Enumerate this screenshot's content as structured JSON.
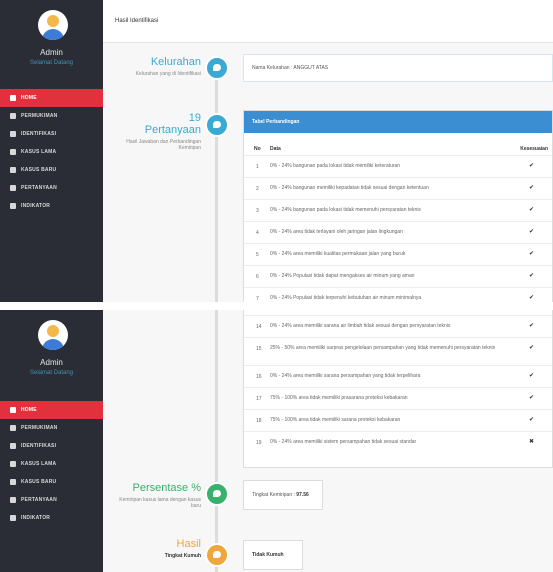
{
  "sidebar": {
    "username": "Admin",
    "role": "Selamat Datang",
    "items": [
      {
        "label": "HOME",
        "icon": "home-icon",
        "active": true
      },
      {
        "label": "PERMUKIMAN",
        "icon": "people-icon",
        "active": false
      },
      {
        "label": "IDENTIFIKASI",
        "icon": "wrench-icon",
        "active": false
      },
      {
        "label": "KASUS LAMA",
        "icon": "bookmark-icon",
        "active": false
      },
      {
        "label": "KASUS BARU",
        "icon": "list-icon",
        "active": false
      },
      {
        "label": "PERTANYAAN",
        "icon": "chat-icon",
        "active": false
      },
      {
        "label": "INDIKATOR",
        "icon": "chart-icon",
        "active": false
      }
    ]
  },
  "header": {
    "title": "Hasil Identifikasi"
  },
  "kelurahan": {
    "title": "Kelurahan",
    "subtitle": "Kelurahan yang di Identifikasi",
    "value": "Nama Kelurahan : ANGGUT ATAS"
  },
  "pertanyaan": {
    "count": "19",
    "title": "Pertanyaan",
    "subtitle": "Hasil Jawaban dan Perbandingan Kemiripan"
  },
  "table": {
    "title": "Tabel Perbandingan",
    "col_no": "No",
    "col_data": "Data",
    "col_match": "Kesesuaian",
    "rows_top": [
      {
        "no": "1",
        "text": "0% - 24% bangunan pada lokasi tidak memiliki keteraturan",
        "mark": "✔"
      },
      {
        "no": "2",
        "text": "0% - 24% bangunan memiliki kepadatan tidak sesuai dengan ketentuan",
        "mark": "✔"
      },
      {
        "no": "3",
        "text": "0% - 24% bangunan pada lokasi tidak memenuhi persyaratan teknis",
        "mark": "✔"
      },
      {
        "no": "4",
        "text": "0% - 24% area tidak terlayani oleh jaringan jalan lingkungan",
        "mark": "✔"
      },
      {
        "no": "5",
        "text": "0% - 24% area memiliki kualitas permukaan jalan yang buruk",
        "mark": "✔"
      },
      {
        "no": "6",
        "text": "0% - 24% Populasi tidak dapat mengakses air minum yang aman",
        "mark": "✔"
      },
      {
        "no": "7",
        "text": "0% - 24% Populasi tidak terpenuhi kebutuhan air minum minimalnya",
        "mark": "✔"
      }
    ],
    "rows_bottom": [
      {
        "no": "14",
        "text": "0% - 24% area memiliki sarana air limbah tidak sesuai dengan persyaratan teknis",
        "mark": "✔"
      },
      {
        "no": "15",
        "text": "25% - 50% area memiliki sarpras pengelolaan persampahan yang tidak memenuhi persyaratan teknis",
        "mark": "✔"
      },
      {
        "no": "16",
        "text": "0% - 24% area memiliki sarana persampahan yang tidak terpelihara",
        "mark": "✔"
      },
      {
        "no": "17",
        "text": "75% - 100% area tidak memiliki prasarana proteksi kebakaran",
        "mark": "✔"
      },
      {
        "no": "18",
        "text": "75% - 100% area tidak memiliki sarana proteksi kebakaran",
        "mark": "✔"
      },
      {
        "no": "19",
        "text": "0% - 24% area memiliki sistem persampahan tidak sesuai standar",
        "mark": "✖"
      }
    ]
  },
  "persentase": {
    "title": "Persentase %",
    "subtitle": "Kemiripan kasus lama dengan kasus baru",
    "label": "Tingkat Kemiripan :",
    "value": "97.56"
  },
  "hasil": {
    "title": "Hasil",
    "subtitle": "Tingkat Kumuh",
    "value": "Tidak Kumuh"
  },
  "colors": {
    "sidebar": "#2a2d36",
    "active": "#e2303c",
    "blue": "#3aaad4",
    "table_header": "#3b8ed1",
    "green": "#39b06b",
    "orange": "#f0a63b"
  }
}
